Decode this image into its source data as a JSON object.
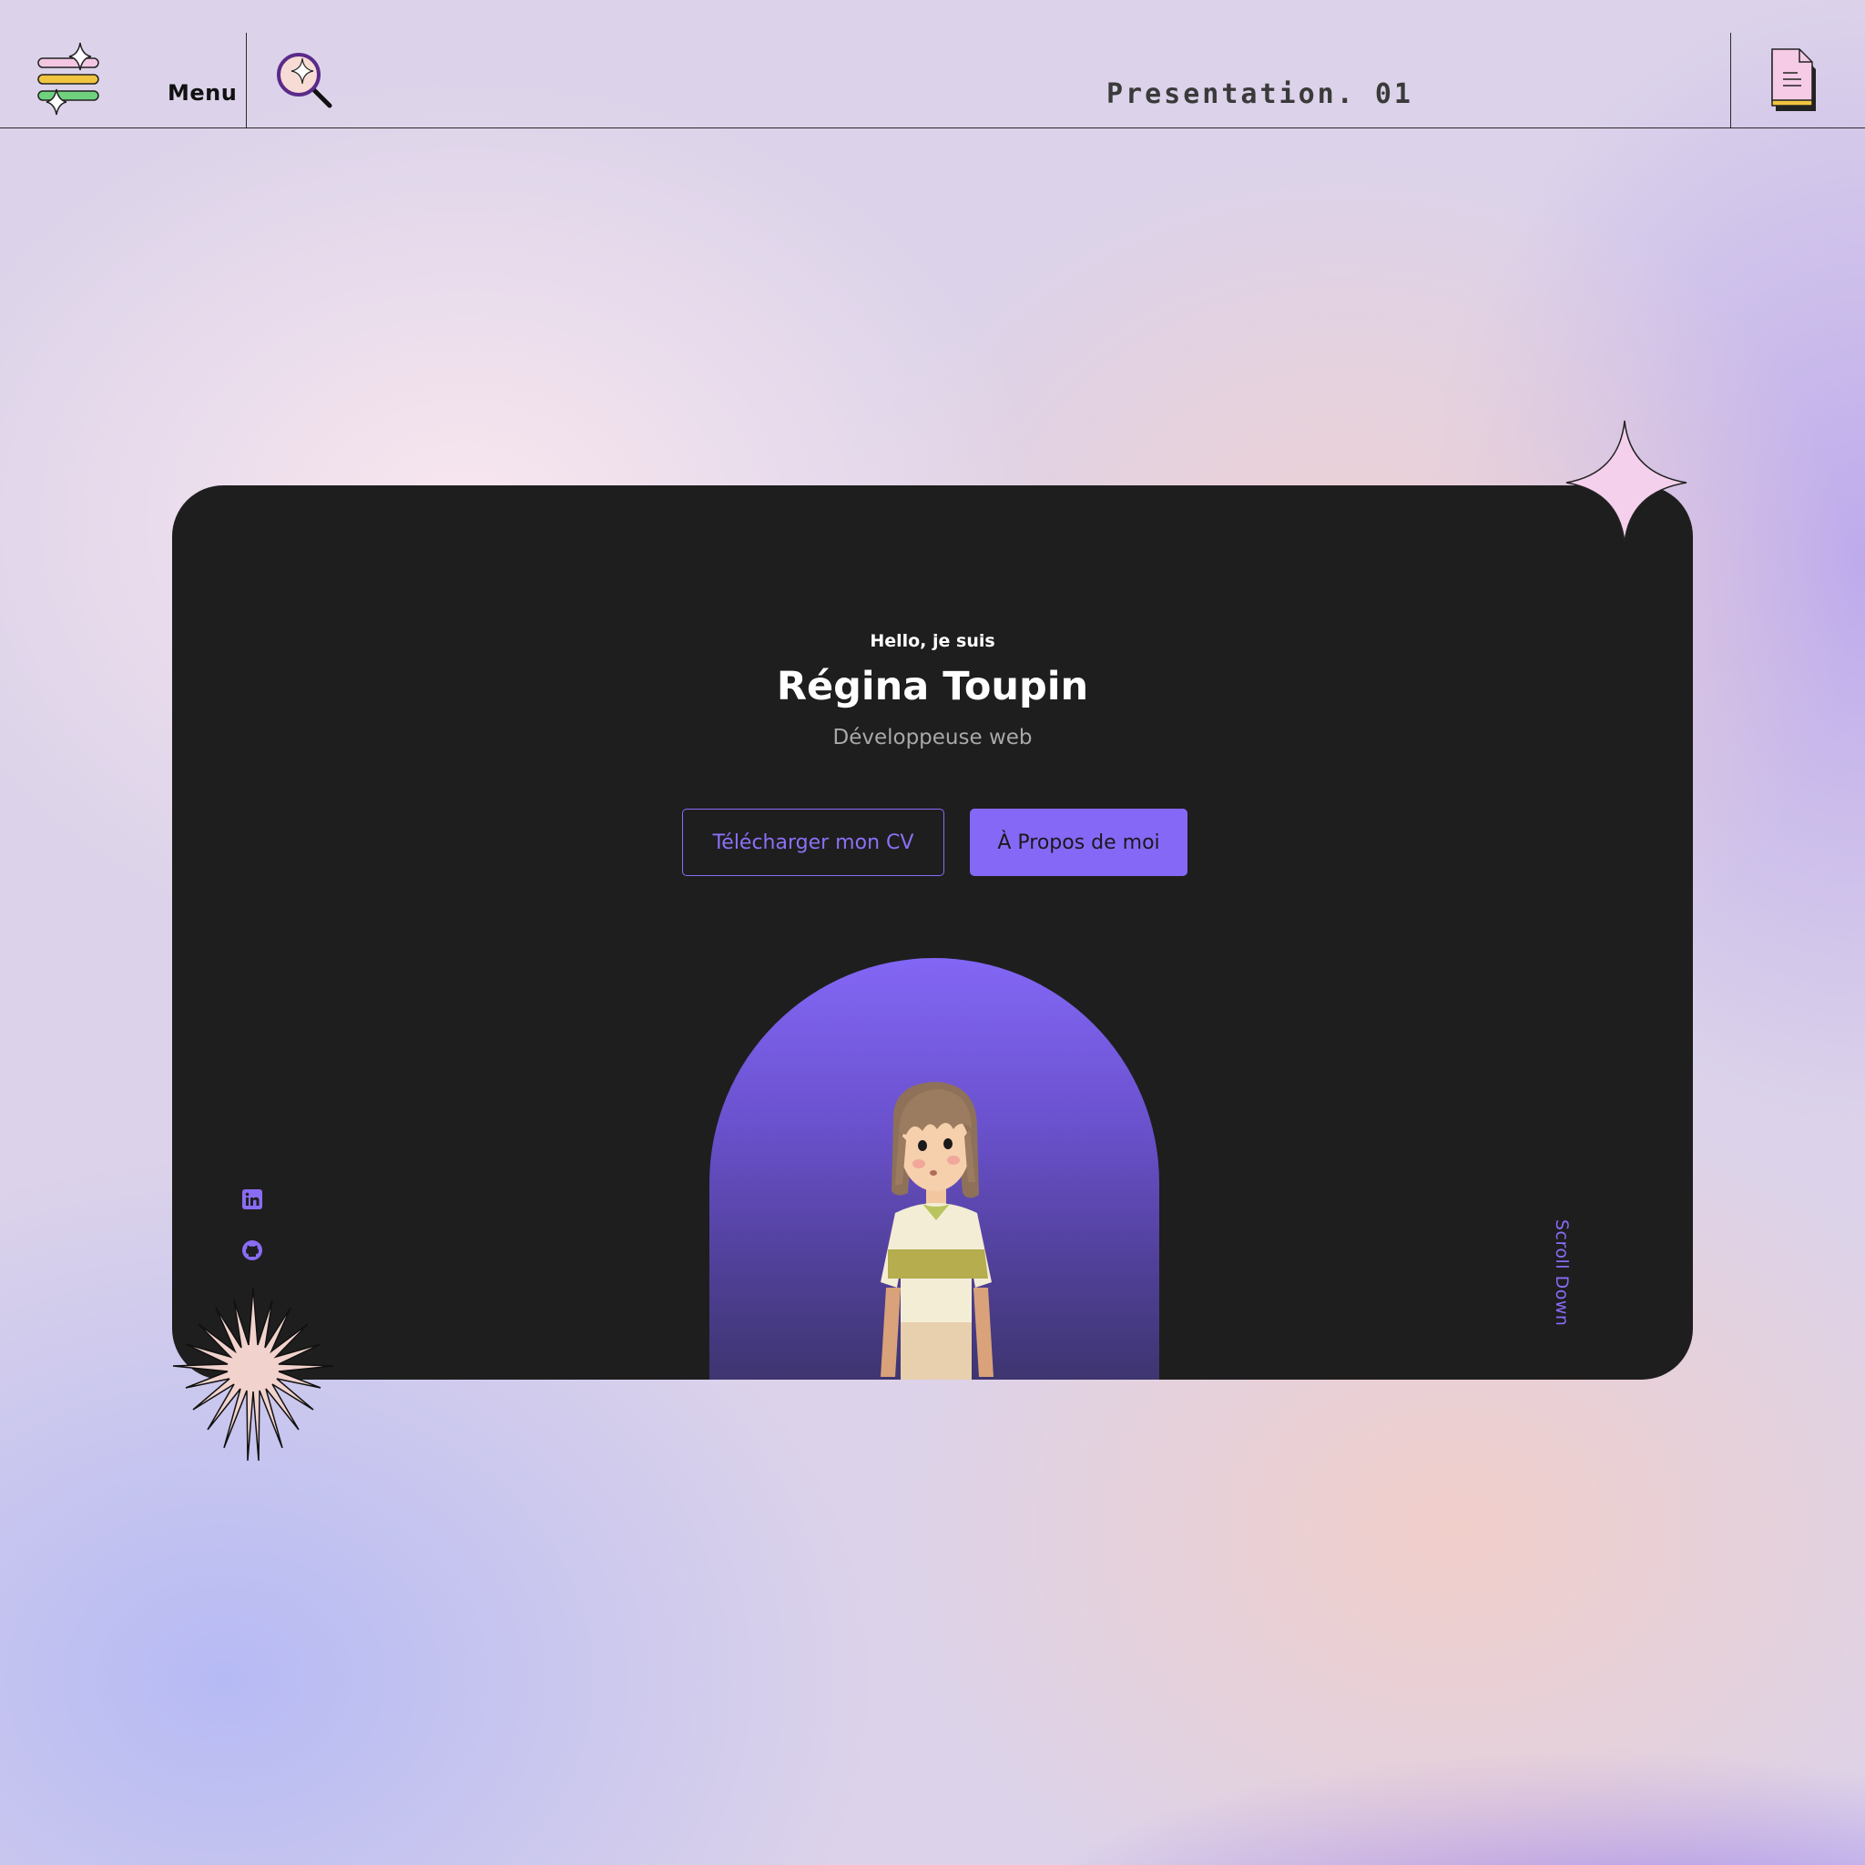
{
  "header": {
    "menu_label": "Menu",
    "presentation_label": "Presentation. 01",
    "icons": [
      "menu-icon",
      "search-icon",
      "document-icon"
    ]
  },
  "hero": {
    "greeting": "Hello, je suis",
    "name": "Régina Toupin",
    "role": "Développeuse web",
    "buttons": {
      "download_cv": "Télécharger mon CV",
      "about_me": "À Propos de moi"
    },
    "scroll_label": "Scroll Down",
    "social": [
      "linkedin-icon",
      "github-icon"
    ]
  },
  "colors": {
    "accent": "#8668f7",
    "card": "#1e1e1e",
    "sparkle_pink": "#f5d0ec",
    "starburst_peach": "#f2d2cc"
  }
}
